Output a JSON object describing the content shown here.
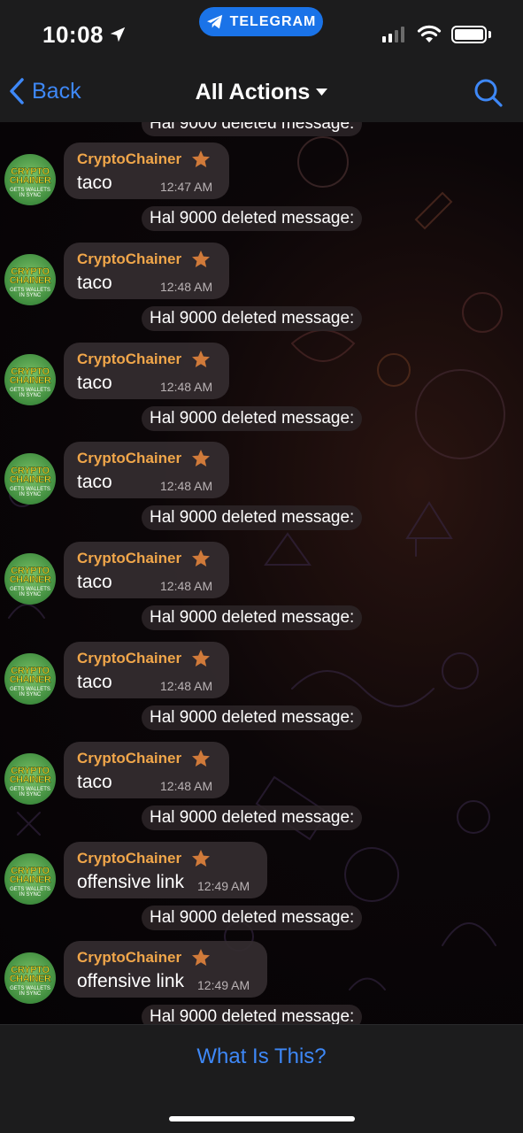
{
  "status_bar": {
    "time": "10:08",
    "app_pill": "TELEGRAM",
    "icons": [
      "location-arrow-icon",
      "telegram-icon",
      "cellular-signal-icon",
      "wifi-icon",
      "battery-icon"
    ]
  },
  "nav": {
    "back_label": "Back",
    "title": "All Actions",
    "icons": [
      "chevron-left-icon",
      "dropdown-triangle-icon",
      "search-icon"
    ]
  },
  "chat": {
    "top_partial_notice": "Hal 9000 deleted message:",
    "avatar": {
      "line1": "CRYPTO",
      "line2": "CHAINER",
      "line3a": "GETS",
      "line3b": "WALLETS",
      "line3c": "IN",
      "line3d": "SYNC"
    },
    "badge_icon": "star-icon",
    "messages": [
      {
        "sender": "CryptoChainer",
        "text": "taco",
        "time": "12:47 AM",
        "notice": "Hal 9000 deleted message:"
      },
      {
        "sender": "CryptoChainer",
        "text": "taco",
        "time": "12:48 AM",
        "notice": "Hal 9000 deleted message:"
      },
      {
        "sender": "CryptoChainer",
        "text": "taco",
        "time": "12:48 AM",
        "notice": "Hal 9000 deleted message:"
      },
      {
        "sender": "CryptoChainer",
        "text": "taco",
        "time": "12:48 AM",
        "notice": "Hal 9000 deleted message:"
      },
      {
        "sender": "CryptoChainer",
        "text": "taco",
        "time": "12:48 AM",
        "notice": "Hal 9000 deleted message:"
      },
      {
        "sender": "CryptoChainer",
        "text": "taco",
        "time": "12:48 AM",
        "notice": "Hal 9000 deleted message:"
      },
      {
        "sender": "CryptoChainer",
        "text": "taco",
        "time": "12:48 AM",
        "notice": "Hal 9000 deleted message:"
      },
      {
        "sender": "CryptoChainer",
        "text": "offensive link",
        "time": "12:49 AM",
        "notice": "Hal 9000 deleted message:"
      },
      {
        "sender": "CryptoChainer",
        "text": "offensive link",
        "time": "12:49 AM",
        "notice": "Hal 9000 deleted message:"
      }
    ]
  },
  "footer": {
    "link_label": "What Is This?"
  },
  "colors": {
    "accent": "#3e88f7",
    "sender_name": "#f0a64a",
    "star": "#d07a3a",
    "bubble": "#342c30",
    "bar_bg": "#1c1c1d"
  }
}
